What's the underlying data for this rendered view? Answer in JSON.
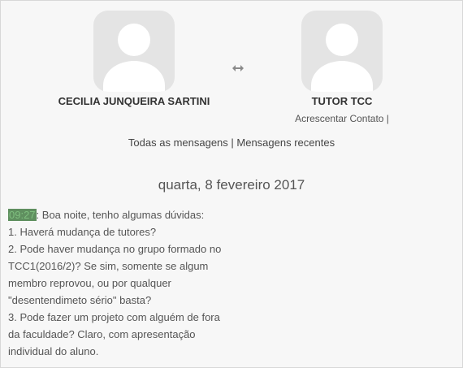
{
  "participants": {
    "left": {
      "name": "CECILIA JUNQUEIRA SARTINI"
    },
    "right": {
      "name": "TUTOR TCC",
      "add_contact": "Acrescentar Contato",
      "separator": " |"
    }
  },
  "swap_icon": "double-arrow-icon",
  "filters": {
    "all": "Todas as mensagens",
    "separator": " | ",
    "recent": "Mensagens recentes"
  },
  "date_heading": "quarta, 8 fevereiro 2017",
  "message": {
    "time": "09:27",
    "lines": [
      ": Boa noite, tenho algumas dúvidas:",
      "1. Haverá mudança de tutores?",
      "2. Pode haver mudança no grupo formado no",
      "TCC1(2016/2)? Se sim, somente se algum",
      "membro reprovou, ou por qualquer",
      "\"desentendimeto sério\" basta?",
      "3. Pode fazer um projeto com alguém de fora",
      "da faculdade? Claro, com apresentação",
      "individual do aluno."
    ]
  },
  "colors": {
    "avatar_bg": "#e4e4e4",
    "time_highlight": "#5f8f5f",
    "background": "#f7f7f7"
  }
}
